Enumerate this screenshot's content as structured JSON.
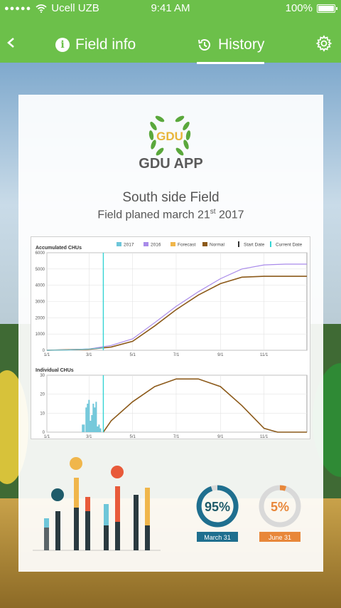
{
  "status_bar": {
    "signal": "●●●●●",
    "carrier": "Ucell UZB",
    "time": "9:41 AM",
    "battery": "100%"
  },
  "nav": {
    "tabs": [
      {
        "label": "Field info"
      },
      {
        "label": "History"
      }
    ]
  },
  "brand": {
    "logo_text": "GDU",
    "app_name": "GDU APP"
  },
  "field": {
    "name": "South side Field",
    "planed_prefix": "Field planed march 21",
    "planed_suffix": "st",
    "planed_year": "2017"
  },
  "colors": {
    "bar": "#6cc04a",
    "y2017": "#6ec6d9",
    "y2016": "#a98bea",
    "forecast": "#f0b64b",
    "normal": "#8c5a1a",
    "current": "#35d4d4"
  },
  "chart_data": [
    {
      "type": "line",
      "title": "Accumulated CHUs",
      "legend": [
        "2017",
        "2016",
        "Forecast",
        "Normal",
        "Start Date",
        "Current Date"
      ],
      "x_ticks": [
        "1/1",
        "3/1",
        "5/1",
        "7/1",
        "9/1",
        "11/1"
      ],
      "y_ticks": [
        0,
        1000,
        2000,
        3000,
        4000,
        5000,
        6000
      ],
      "ylim": [
        0,
        6000
      ],
      "current_date": "3/21",
      "series": [
        {
          "name": "2016",
          "x": [
            "1/1",
            "3/1",
            "4/1",
            "5/1",
            "6/1",
            "7/1",
            "8/1",
            "9/1",
            "10/1",
            "11/1",
            "12/1",
            "12/31"
          ],
          "values": [
            0,
            80,
            300,
            700,
            1700,
            2700,
            3600,
            4400,
            5000,
            5250,
            5300,
            5300
          ]
        },
        {
          "name": "Normal",
          "x": [
            "1/1",
            "3/1",
            "4/1",
            "5/1",
            "6/1",
            "7/1",
            "8/1",
            "9/1",
            "10/1",
            "11/1",
            "12/1",
            "12/31"
          ],
          "values": [
            0,
            60,
            200,
            550,
            1500,
            2500,
            3400,
            4100,
            4500,
            4550,
            4550,
            4550
          ]
        },
        {
          "name": "2017",
          "x": [
            "1/1",
            "2/1",
            "3/1",
            "3/21"
          ],
          "values": [
            0,
            20,
            80,
            150
          ]
        }
      ]
    },
    {
      "type": "bar",
      "title": "Individual CHUs",
      "x_ticks": [
        "1/1",
        "3/1",
        "5/1",
        "7/1",
        "9/1",
        "11/1"
      ],
      "y_ticks": [
        0,
        10,
        20,
        30
      ],
      "ylim": [
        0,
        30
      ],
      "series": [
        {
          "name": "2017",
          "x": [
            "2/20",
            "2/22",
            "2/25",
            "2/27",
            "3/1",
            "3/3",
            "3/5",
            "3/7",
            "3/9",
            "3/11",
            "3/13",
            "3/15",
            "3/17"
          ],
          "values": [
            4,
            4,
            13,
            15,
            17,
            6,
            9,
            15,
            13,
            16,
            3,
            4,
            2
          ]
        },
        {
          "name": "Normal",
          "x": [
            "3/21",
            "4/1",
            "5/1",
            "6/1",
            "7/1",
            "8/1",
            "9/1",
            "10/1",
            "11/1",
            "11/20",
            "12/31"
          ],
          "values": [
            0,
            6,
            16,
            24,
            28,
            28,
            24,
            14,
            2,
            0,
            0
          ]
        }
      ]
    }
  ]
}
